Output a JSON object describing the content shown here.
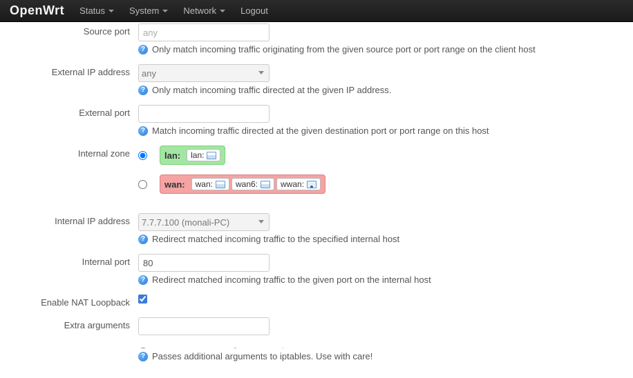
{
  "nav": {
    "brand": "OpenWrt",
    "items": [
      "Status",
      "System",
      "Network",
      "Logout"
    ]
  },
  "fields": {
    "source_port": {
      "label": "Source port",
      "placeholder": "any",
      "help": "Only match incoming traffic originating from the given source port or port range on the client host"
    },
    "external_ip": {
      "label": "External IP address",
      "value": "any",
      "help": "Only match incoming traffic directed at the given IP address."
    },
    "external_port": {
      "label": "External port",
      "value": "",
      "help": "Match incoming traffic directed at the given destination port or port range on this host"
    },
    "internal_zone": {
      "label": "Internal zone",
      "lan": {
        "name": "lan:",
        "ifaces": [
          "lan:"
        ]
      },
      "wan": {
        "name": "wan:",
        "ifaces": [
          "wan:",
          "wan6:",
          "wwan:"
        ]
      }
    },
    "internal_ip": {
      "label": "Internal IP address",
      "value": "7.7.7.100 (monali-PC)",
      "help": "Redirect matched incoming traffic to the specified internal host"
    },
    "internal_port": {
      "label": "Internal port",
      "value": "80",
      "help": "Redirect matched incoming traffic to the given port on the internal host"
    },
    "nat_loopback": {
      "label": "Enable NAT Loopback"
    },
    "extra_args": {
      "label": "Extra arguments",
      "help": "Passes additional arguments to iptables. Use with care!"
    }
  }
}
